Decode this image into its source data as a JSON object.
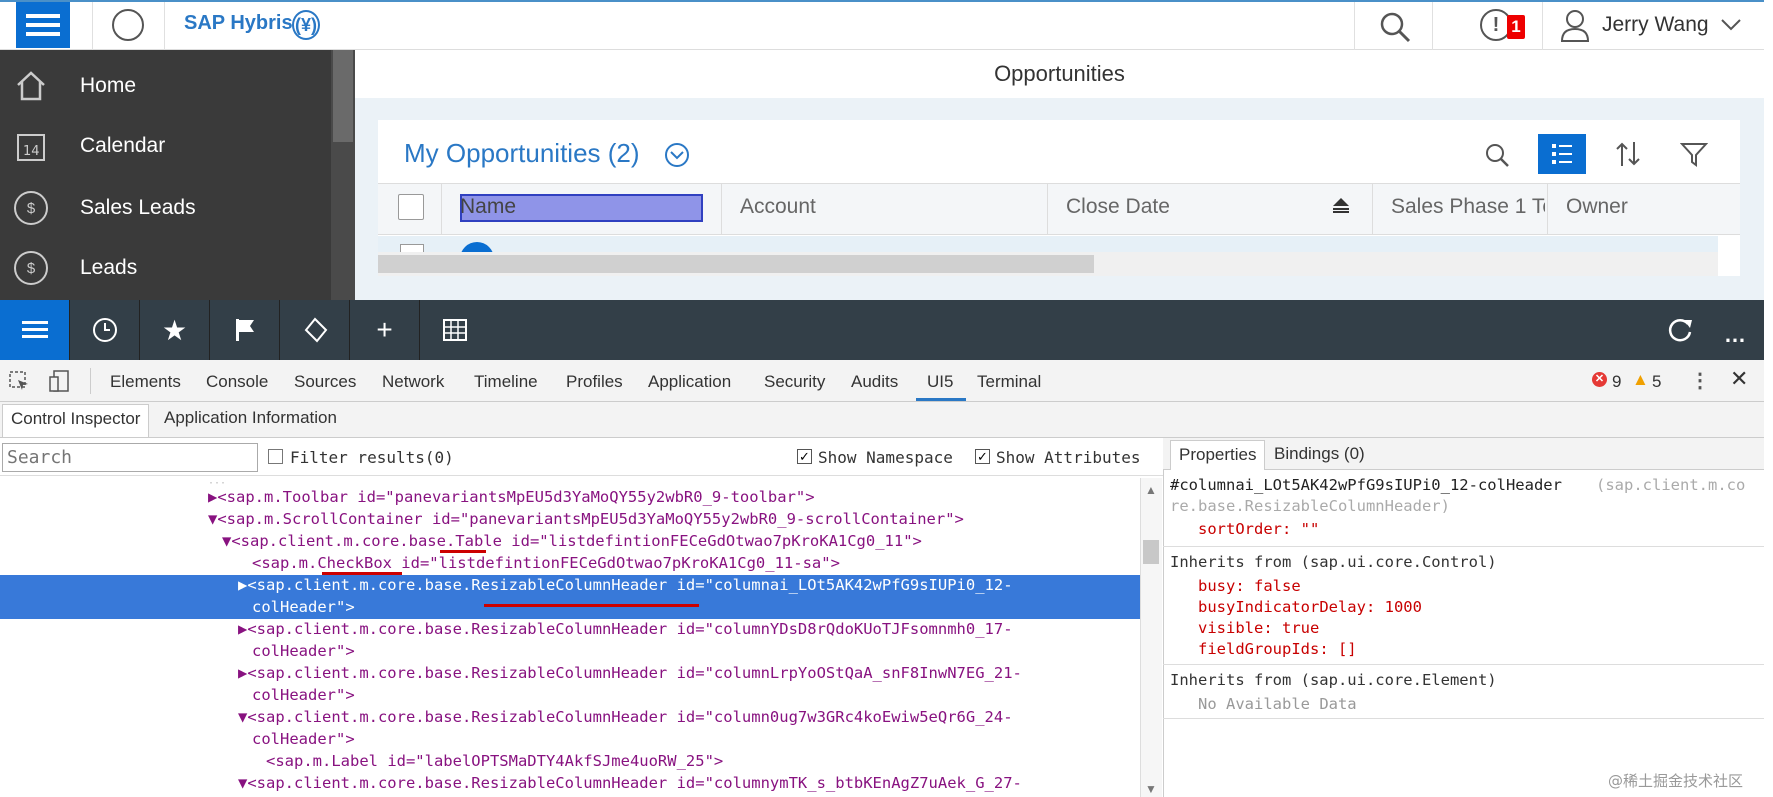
{
  "shell": {
    "brand": "SAP Hybris",
    "brand_logo": "(¥)",
    "user_name": "Jerry Wang",
    "notif_count": "1"
  },
  "sidebar": {
    "items": [
      {
        "label": "Home",
        "icon": "home-icon"
      },
      {
        "label": "Calendar",
        "icon": "calendar-icon"
      },
      {
        "label": "Sales Leads",
        "icon": "dollar-icon"
      },
      {
        "label": "Leads",
        "icon": "leads-icon"
      }
    ]
  },
  "main": {
    "page_title": "Opportunities",
    "card_title": "My Opportunities  (2)",
    "columns": [
      "Name",
      "Account",
      "Close Date",
      "Sales Phase 1 To",
      "Owner"
    ]
  },
  "devtools": {
    "tabs": [
      "Elements",
      "Console",
      "Sources",
      "Network",
      "Timeline",
      "Profiles",
      "Application",
      "Security",
      "Audits",
      "UI5",
      "Terminal"
    ],
    "error_count": "9",
    "warning_count": "5",
    "sub_tabs": [
      "Control Inspector",
      "Application Information"
    ],
    "search_placeholder": "Search",
    "filter_label": "Filter results(0)",
    "show_namespace": "Show Namespace",
    "show_attributes": "Show Attributes",
    "tree": [
      {
        "text": "▶<sap.m.Toolbar id=\"panevariantsMpEU5d3YaMoQY55y2wbR0_9-toolbar\">"
      },
      {
        "text": "▼<sap.m.ScrollContainer id=\"panevariantsMpEU5d3YaMoQY55y2wbR0_9-scrollContainer\">"
      },
      {
        "text": "▼<sap.client.m.core.base.Table id=\"listdefintionFECeGdOtwao7pKroKA1Cg0_11\">"
      },
      {
        "text": "<sap.m.CheckBox id=\"listdefintionFECeGdOtwao7pKroKA1Cg0_11-sa\">"
      },
      {
        "text": "▶<sap.client.m.core.base.ResizableColumnHeader id=\"columnai_LOt5AK42wPfG9sIUPi0_12-"
      },
      {
        "text": "colHeader\">"
      },
      {
        "text": "▶<sap.client.m.core.base.ResizableColumnHeader id=\"columnYDsD8rQdoKUoTJFsomnmh0_17-"
      },
      {
        "text": "colHeader\">"
      },
      {
        "text": "▶<sap.client.m.core.base.ResizableColumnHeader id=\"columnLrpYoOStQaA_snF8InwN7EG_21-"
      },
      {
        "text": "colHeader\">"
      },
      {
        "text": "▼<sap.client.m.core.base.ResizableColumnHeader id=\"column0ug7w3GRc4koEwiw5eQr6G_24-"
      },
      {
        "text": "colHeader\">"
      },
      {
        "text": "<sap.m.Label id=\"labelOPTSMaDTY4AkfSJme4uoRW_25\">"
      },
      {
        "text": "▼<sap.client.m.core.base.ResizableColumnHeader id=\"columnymTK_s_btbKEnAgZ7uAek_G_27-"
      }
    ],
    "props_tabs": [
      "Properties",
      "Bindings (0)"
    ],
    "selected_id": "#columnai_LOt5AK42wPfG9sIUPi0_12-colHeader",
    "selected_type": "(sap.client.m.co",
    "selected_type2": "re.base.ResizableColumnHeader)",
    "sort_order": "sortOrder: \"\"",
    "inherits_control": "Inherits from (sap.ui.core.Control)",
    "control_props": [
      "busy: false",
      "busyIndicatorDelay: 1000",
      "visible: true",
      "fieldGroupIds: []"
    ],
    "inherits_element": "Inherits from (sap.ui.core.Element)",
    "no_data": "No Available Data"
  },
  "watermark": "@稀土掘金技术社区"
}
